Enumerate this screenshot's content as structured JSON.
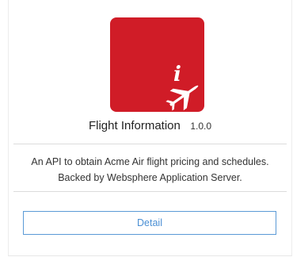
{
  "api_card": {
    "logo": {
      "icon": "flight-information-icon",
      "background_color": "#d01c27"
    },
    "name": "Flight Information",
    "version": "1.0.0",
    "description_line1": "An API to obtain Acme Air flight pricing and schedules.",
    "description_line2": "Backed by Websphere Application Server.",
    "detail_button_label": "Detail",
    "accent_color": "#4a8fd4"
  }
}
